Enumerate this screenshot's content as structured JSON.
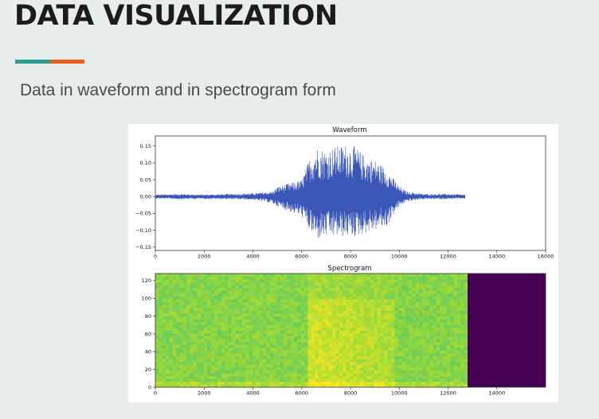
{
  "slide": {
    "title": "DATA VISUALIZATION",
    "subtitle": "Data in waveform and in spectrogram form",
    "accent_colors": [
      "#2a9d8f",
      "#e8601c"
    ]
  },
  "chart_data": [
    {
      "type": "line",
      "title": "Waveform",
      "xlabel": "",
      "ylabel": "",
      "xlim": [
        0,
        16000
      ],
      "ylim": [
        -0.16,
        0.18
      ],
      "xticks": [
        0,
        2000,
        4000,
        6000,
        8000,
        10000,
        12000,
        14000,
        16000
      ],
      "yticks": [
        0.15,
        0.1,
        0.05,
        0.0,
        -0.05,
        -0.1,
        -0.15
      ],
      "ytick_labels": [
        "0.15",
        "0.10",
        "0.05",
        "0.00",
        "−0.05",
        "−0.10",
        "−0.15"
      ],
      "series": [
        {
          "color": "#3a57b8",
          "samples_end": 12700,
          "envelope": {
            "x": [
              0,
              1000,
              2000,
              3000,
              4000,
              4800,
              5000,
              5500,
              6000,
              6300,
              6600,
              7000,
              7400,
              7800,
              8200,
              8600,
              9000,
              9500,
              9800,
              10000,
              10300,
              11000,
              12000,
              12700
            ],
            "upper": [
              0.006,
              0.008,
              0.006,
              0.008,
              0.01,
              0.015,
              0.03,
              0.04,
              0.05,
              0.11,
              0.15,
              0.14,
              0.15,
              0.155,
              0.15,
              0.12,
              0.11,
              0.08,
              0.05,
              0.03,
              0.015,
              0.008,
              0.008,
              0.006
            ],
            "lower": [
              -0.006,
              -0.008,
              -0.007,
              -0.008,
              -0.01,
              -0.02,
              -0.03,
              -0.045,
              -0.06,
              -0.1,
              -0.13,
              -0.12,
              -0.12,
              -0.12,
              -0.12,
              -0.11,
              -0.1,
              -0.09,
              -0.05,
              -0.03,
              -0.015,
              -0.008,
              -0.008,
              -0.006
            ]
          }
        }
      ]
    },
    {
      "type": "heatmap",
      "title": "Spectrogram",
      "xlabel": "",
      "ylabel": "",
      "xlim": [
        0,
        16000
      ],
      "ylim": [
        0,
        128
      ],
      "xticks": [
        0,
        2000,
        4000,
        6000,
        8000,
        10000,
        12000,
        14000
      ],
      "yticks": [
        0,
        20,
        40,
        60,
        80,
        100,
        120
      ],
      "colormap": "viridis",
      "signal_end_x": 12800,
      "padding_color": "#440154",
      "level": {
        "background": 0.78,
        "speech_region_x": [
          6300,
          9800
        ],
        "speech_level": 0.92,
        "noise": 0.06
      }
    }
  ]
}
